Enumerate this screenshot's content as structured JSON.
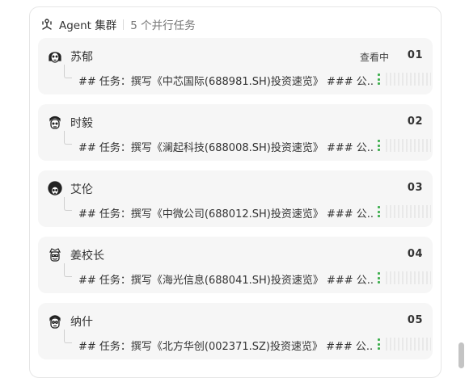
{
  "header": {
    "title": "Agent 集群",
    "count": "5 个并行任务"
  },
  "agents": [
    {
      "name": "苏郁",
      "status": "查看中",
      "index": "01",
      "task": "## 任务：撰写《中芯国际(688981.SH)投资速览》 ### 公..."
    },
    {
      "name": "时毅",
      "status": "",
      "index": "02",
      "task": "## 任务：撰写《澜起科技(688008.SH)投资速览》 ### 公..."
    },
    {
      "name": "艾伦",
      "status": "",
      "index": "03",
      "task": "## 任务：撰写《中微公司(688012.SH)投资速览》 ### 公..."
    },
    {
      "name": "姜校长",
      "status": "",
      "index": "04",
      "task": "## 任务：撰写《海光信息(688041.SH)投资速览》 ### 公..."
    },
    {
      "name": "纳什",
      "status": "",
      "index": "05",
      "task": "## 任务：撰写《北方华创(002371.SZ)投资速览》 ### 公..."
    }
  ],
  "colors": {
    "progress_dots": "#3fae4f",
    "card_bg": "#f6f6f6"
  },
  "icons": {
    "header": "agent-cluster-icon",
    "avatars": "agent-avatar-icon"
  }
}
